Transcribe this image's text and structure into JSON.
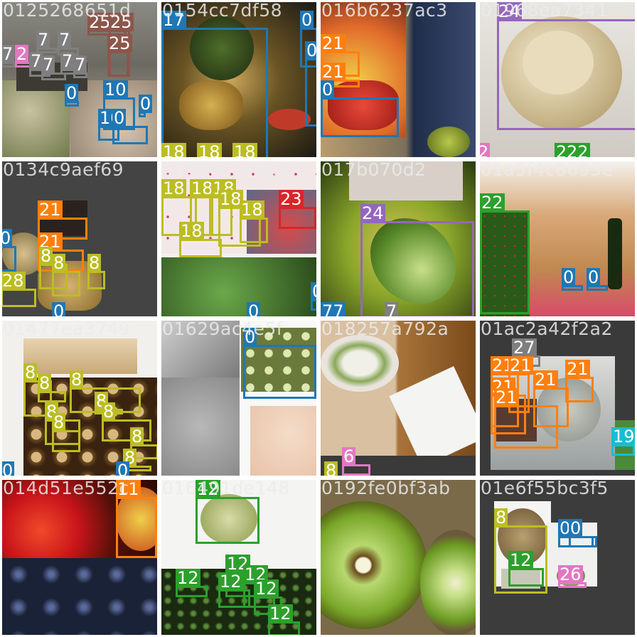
{
  "class_colors": {
    "0": "#1f77b4",
    "2": "#e377c2",
    "6": "#e377c2",
    "7": "#7f7f7f",
    "8": "#bcbd22",
    "10": "#1f77b4",
    "11": "#ff7f0e",
    "12": "#2ca02c",
    "18": "#bcbd22",
    "19": "#17becf",
    "21": "#ff7f0e",
    "22": "#2ca02c",
    "23": "#d62728",
    "24": "#9467bd",
    "25": "#8c564b",
    "26": "#e377c2",
    "27": "#7f7f7f",
    "28": "#bcbd22"
  },
  "tiles": [
    {
      "title": "0125268651d",
      "scene": "mixed produce collage with potatoes and vegetables",
      "labels": [
        "25",
        "25",
        "25",
        "7",
        "7",
        "2",
        "7",
        "7",
        "7",
        "7",
        "7",
        "0",
        "10",
        "0",
        "10",
        "0"
      ]
    },
    {
      "title": "0154cc7df58",
      "scene": "pineapple and fruit on a table",
      "labels": [
        "17",
        "0",
        "0",
        "18",
        "18",
        "18"
      ]
    },
    {
      "title": "016b6237ac3",
      "scene": "bowl of fruit salad with strawberries",
      "labels": [
        "21",
        "21",
        "0"
      ]
    },
    {
      "title": "01968ea7341",
      "scene": "cut grapefruit rind",
      "labels": [
        "24",
        "2",
        "22",
        "22"
      ]
    },
    {
      "title": "0134c9aef69",
      "scene": "grocery items on grey background",
      "labels": [
        "21",
        "0",
        "21",
        "8",
        "8",
        "8",
        "28",
        "0"
      ]
    },
    {
      "title": "01576c72fddd",
      "scene": "fruit stand and garden plants",
      "labels": [
        "18",
        "18",
        "18",
        "18",
        "18",
        "23",
        "18",
        "0",
        "0"
      ]
    },
    {
      "title": "017b070d2",
      "scene": "caterpillar on green zucchini stem",
      "labels": [
        "24",
        "77",
        "7"
      ]
    },
    {
      "title": "01a5f4c8693e",
      "scene": "tomatoes and wine bottle in cafe",
      "labels": [
        "22",
        "0",
        "0"
      ]
    },
    {
      "title": "01477ea3749",
      "scene": "crate of kiwi fruit with stickers",
      "labels": [
        "8",
        "8",
        "8",
        "8",
        "8",
        "8",
        "8",
        "8",
        "8",
        "0",
        "0"
      ]
    },
    {
      "title": "01629ac4e5f",
      "scene": "market apples in crate",
      "labels": [
        "0"
      ]
    },
    {
      "title": "018257a792a",
      "scene": "salad plate and receipt",
      "labels": [
        "6",
        "8"
      ]
    },
    {
      "title": "01ac2a42f2a2",
      "scene": "produce in refrigerator",
      "labels": [
        "27",
        "21",
        "21",
        "21",
        "21",
        "21",
        "21",
        "19"
      ]
    },
    {
      "title": "014d51e552c",
      "scene": "red apples above blueberries",
      "labels": [
        "11"
      ]
    },
    {
      "title": "016491de148",
      "scene": "green melon above leafy greens",
      "labels": [
        "12",
        "12",
        "12",
        "12",
        "12",
        "12",
        "12"
      ]
    },
    {
      "title": "0192fe0bf3ab",
      "scene": "halved kiwi fruit",
      "labels": []
    },
    {
      "title": "01e6f55bc3f5",
      "scene": "kiwi and small produce items",
      "labels": [
        "8",
        "0",
        "0",
        "12",
        "26"
      ]
    }
  ]
}
